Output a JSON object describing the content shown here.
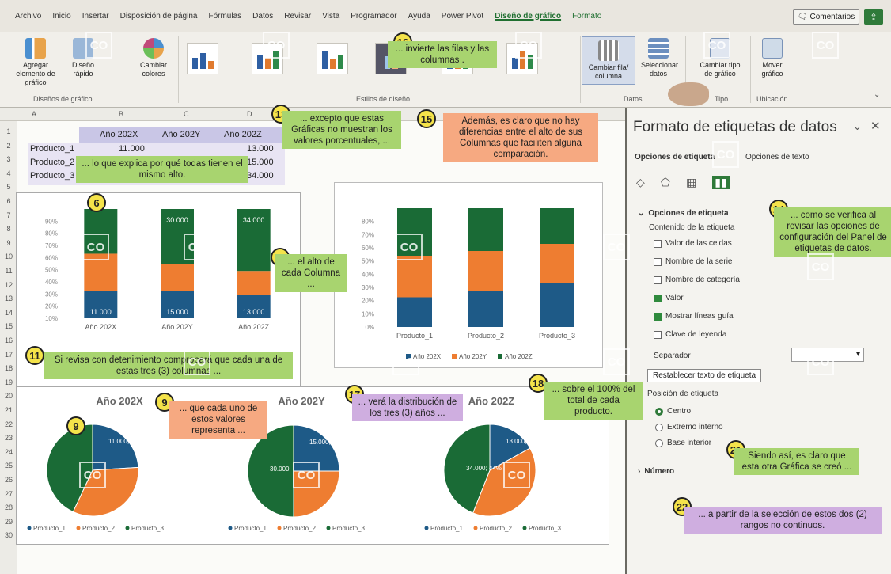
{
  "ribbon_tabs": [
    "Archivo",
    "Inicio",
    "Insertar",
    "Disposición de página",
    "Fórmulas",
    "Datos",
    "Revisar",
    "Vista",
    "Programador",
    "Ayuda",
    "Power Pivot",
    "Diseño de gráfico",
    "Formato"
  ],
  "active_tab": "Diseño de gráfico",
  "comments_label": "Comentarios",
  "ribbon": {
    "add_element": "Agregar elemento de gráfico",
    "quick_layout": "Diseño rápido",
    "change_colors": "Cambiar colores",
    "group_layouts": "Diseños de gráfico",
    "group_styles": "Estilos de diseño",
    "switch_row_col": "Cambiar fila/ columna",
    "select_data": "Seleccionar datos",
    "group_data": "Datos",
    "change_type": "Cambiar tipo de gráfico",
    "group_type": "Tipo",
    "move_chart": "Mover gráfico",
    "group_location": "Ubicación"
  },
  "columns": [
    "A",
    "B",
    "C",
    "D"
  ],
  "rows": [
    "1",
    "2",
    "3",
    "4",
    "5",
    "6",
    "7",
    "8",
    "9",
    "10",
    "11",
    "12",
    "13",
    "14",
    "15",
    "16",
    "17",
    "18",
    "19",
    "20",
    "21",
    "22",
    "23",
    "24",
    "25",
    "26",
    "27",
    "28",
    "29",
    "30"
  ],
  "table": {
    "headers": [
      "Año 202X",
      "Año 202Y",
      "Año 202Z"
    ],
    "row_labels": [
      "Producto_1",
      "Producto_2",
      "Producto_3"
    ],
    "first_value": "11.000",
    "col3_values": [
      "13.000",
      "15.000",
      "34.000"
    ]
  },
  "chart_data": [
    {
      "type": "bar",
      "stacked": "percent",
      "categories": [
        "Año 202X",
        "Año 202Y",
        "Año 202Z"
      ],
      "series": [
        {
          "name": "Producto_1",
          "values": [
            11000,
            15000,
            13000
          ],
          "color": "#1e5a87"
        },
        {
          "name": "Producto_2",
          "values": [
            15000,
            15000,
            13000
          ],
          "color": "#ee7d31"
        },
        {
          "name": "Producto_3",
          "values": [
            18000,
            30000,
            34000
          ],
          "color": "#1a6b36"
        }
      ],
      "data_labels": [
        "11.000",
        "15.000",
        "13.000",
        "30.000",
        "34.000"
      ],
      "yticks": [
        "10%",
        "20%",
        "30%",
        "40%",
        "50%",
        "60%",
        "70%",
        "80%",
        "90%"
      ]
    },
    {
      "type": "bar",
      "stacked": "percent",
      "categories": [
        "Producto_1",
        "Producto_2",
        "Producto_3"
      ],
      "series": [
        {
          "name": "Año 202X",
          "values": [
            25,
            30,
            37
          ],
          "color": "#1e5a87"
        },
        {
          "name": "Año 202Y",
          "values": [
            35,
            34,
            33
          ],
          "color": "#ee7d31"
        },
        {
          "name": "Año 202Z",
          "values": [
            40,
            36,
            30
          ],
          "color": "#1a6b36"
        }
      ],
      "yticks": [
        "0%",
        "10%",
        "20%",
        "30%",
        "40%",
        "50%",
        "60%",
        "70%",
        "80%"
      ]
    },
    {
      "type": "pie",
      "title": "Año 202X",
      "labels": [
        "Producto_1",
        "Producto_2",
        "Producto_3"
      ],
      "values": [
        24,
        33,
        43
      ],
      "data_labels": [
        "11.000; 24%"
      ],
      "colors": [
        "#1e5a87",
        "#ee7d31",
        "#1a6b36"
      ]
    },
    {
      "type": "pie",
      "title": "Año 202Y",
      "labels": [
        "Producto_1",
        "Producto_2",
        "Producto_3"
      ],
      "values": [
        25,
        25,
        50
      ],
      "data_labels": [
        "15.000; 25%",
        "30.000"
      ],
      "colors": [
        "#1e5a87",
        "#ee7d31",
        "#1a6b36"
      ]
    },
    {
      "type": "pie",
      "title": "Año 202Z",
      "labels": [
        "Producto_1",
        "Producto_2",
        "Producto_3"
      ],
      "values": [
        17,
        39,
        44
      ],
      "data_labels": [
        "13.000; 17%",
        "34.000; 44%"
      ],
      "colors": [
        "#1e5a87",
        "#ee7d31",
        "#1a6b36"
      ]
    }
  ],
  "pie_legend": [
    "Producto_1",
    "Producto_2",
    "Producto_3"
  ],
  "pane": {
    "title": "Formato de etiquetas de datos",
    "tab1": "Opciones de etiqueta",
    "tab2": "Opciones de texto",
    "section": "Opciones de etiqueta",
    "content_label": "Contenido de la etiqueta",
    "options": [
      "Valor de las celdas",
      "Nombre de la serie",
      "Nombre de categoría",
      "Valor",
      "Mostrar líneas guía",
      "Clave de leyenda"
    ],
    "checked": [
      false,
      false,
      false,
      true,
      true,
      false
    ],
    "separator_label": "Separador",
    "separator_value": "",
    "reset_button": "Restablecer texto de etiqueta",
    "position_label": "Posición de etiqueta",
    "positions": [
      "Centro",
      "Extremo interno",
      "Base interior"
    ],
    "selected_position": "Centro",
    "number_section": "Número"
  },
  "callouts": {
    "c6": "6",
    "c9a": "9",
    "c9b": "9",
    "c9_text": "... que cada uno de estos valores representa ...",
    "c11": "11",
    "c11_text": "Si revisa con detenimiento comprobará que cada una de estas tres (3) columnas ...",
    "c12_text": "... lo que explica por qué todas tienen el mismo alto.",
    "c12b_text": "... el alto de cada Columna ...",
    "c2": "2",
    "c13": "13",
    "c13_text": "... excepto que estas Gráficas no muestran los valores porcentuales, ...",
    "c14": "14",
    "c14_text": "... como se verifica al revisar las opciones de configuración del Panel de etiquetas de datos.",
    "c15": "15",
    "c15_text": "Además, es claro que no hay diferencias entre el alto de sus Columnas que faciliten alguna comparación.",
    "c16": "16",
    "c16_text": "... invierte las filas y las columnas .",
    "c17": "17",
    "c17_text": "... verá la distribución de los tres (3) años ...",
    "c18": "18",
    "c18_text": "... sobre el 100% del total de cada producto.",
    "c21": "21",
    "c21_text": "Siendo así, es claro que esta otra Gráfica se creó ...",
    "c22": "22",
    "c22_text": "... a partir de la selección de estos dos (2) rangos no continuos."
  },
  "watermark": "CO"
}
